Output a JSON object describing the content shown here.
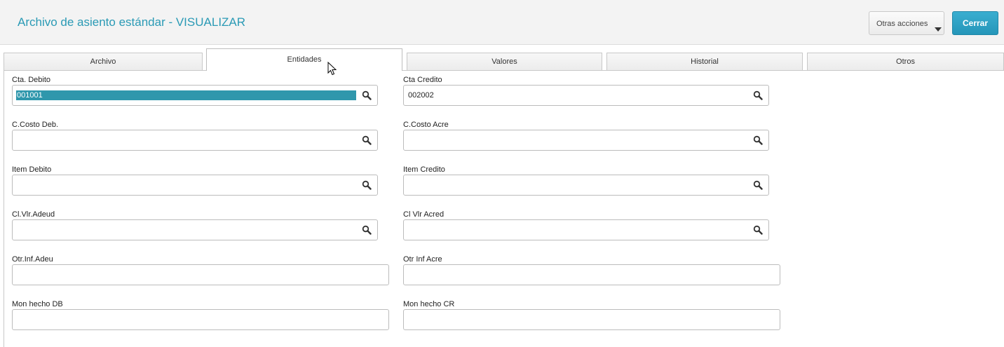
{
  "header": {
    "title": "Archivo de asiento estándar - VISUALIZAR",
    "other_actions_label": "Otras acciones",
    "close_label": "Cerrar"
  },
  "tabs": [
    {
      "label": "Archivo",
      "active": false
    },
    {
      "label": "Entidades",
      "active": true
    },
    {
      "label": "Valores",
      "active": false
    },
    {
      "label": "Historial",
      "active": false
    },
    {
      "label": "Otros",
      "active": false
    }
  ],
  "fields": {
    "cta_debito": {
      "label": "Cta. Debito",
      "value": "001001"
    },
    "cta_credito": {
      "label": "Cta Credito",
      "value": "002002"
    },
    "ccosto_deb": {
      "label": "C.Costo Deb.",
      "value": ""
    },
    "ccosto_acre": {
      "label": "C.Costo Acre",
      "value": ""
    },
    "item_debito": {
      "label": "Item Debito",
      "value": ""
    },
    "item_credito": {
      "label": "Item Credito",
      "value": ""
    },
    "cl_vlr_adeud": {
      "label": "Cl.Vlr.Adeud",
      "value": ""
    },
    "cl_vlr_acred": {
      "label": "Cl Vlr Acred",
      "value": ""
    },
    "otr_inf_adeu": {
      "label": "Otr.Inf.Adeu",
      "value": ""
    },
    "otr_inf_acre": {
      "label": "Otr Inf Acre",
      "value": ""
    },
    "mon_hecho_db": {
      "label": "Mon hecho DB",
      "value": ""
    },
    "mon_hecho_cr": {
      "label": "Mon hecho CR",
      "value": ""
    }
  },
  "colors": {
    "accent": "#2a9ab5",
    "close_button": "#2596b9",
    "selection": "#2f97ac"
  },
  "icons": {
    "lookup": "search-icon",
    "dropdown": "caret-down-icon",
    "pointer": "mouse-cursor-icon"
  }
}
